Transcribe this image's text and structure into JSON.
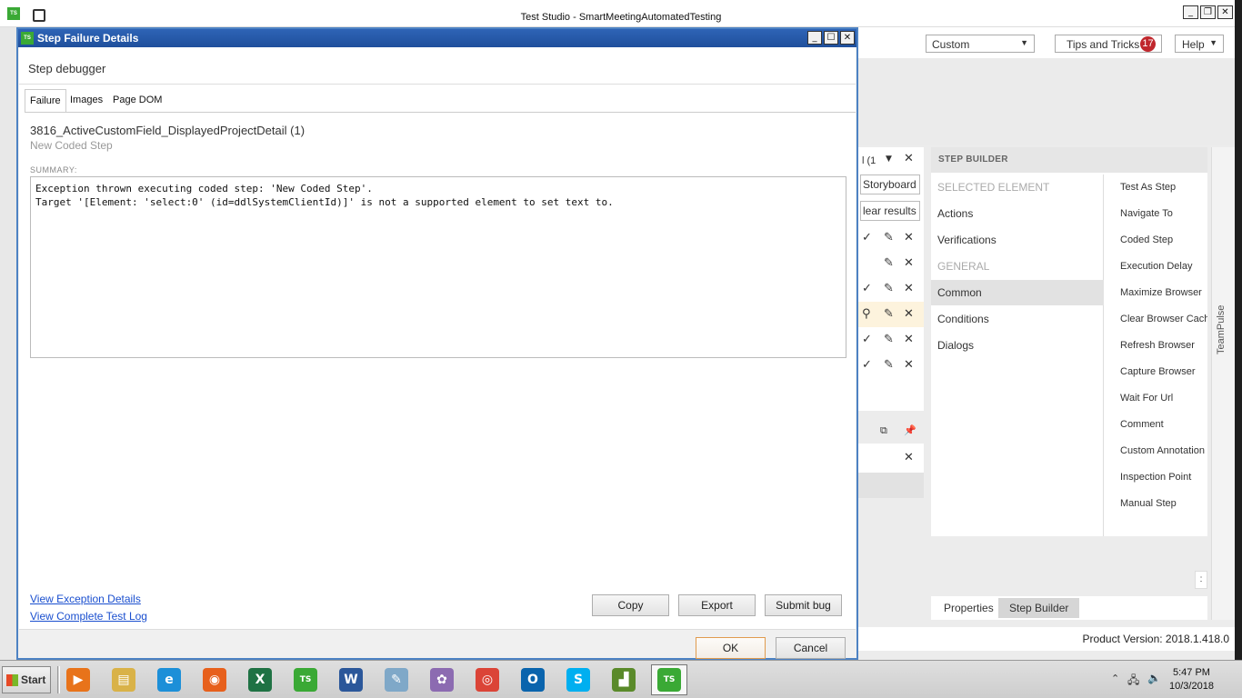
{
  "main_window": {
    "title": "Test Studio - SmartMeetingAutomatedTesting",
    "app_logo": "TS",
    "minimize": "_",
    "restore": "❐",
    "close": "✕"
  },
  "ribbon": {
    "view_select": "Custom",
    "tips_label": "Tips and Tricks",
    "tips_count": "17",
    "help_label": "Help"
  },
  "mid_panel": {
    "tab_fragment": "l (1",
    "storyboard": "Storyboard",
    "clear_results": "lear results"
  },
  "step_builder": {
    "header": "STEP BUILDER",
    "groups": [
      {
        "label": "SELECTED ELEMENT",
        "type": "group"
      },
      {
        "label": "Actions",
        "type": "item"
      },
      {
        "label": "Verifications",
        "type": "item"
      },
      {
        "label": "GENERAL",
        "type": "group"
      },
      {
        "label": "Common",
        "type": "active"
      },
      {
        "label": "Conditions",
        "type": "item"
      },
      {
        "label": "Dialogs",
        "type": "item"
      }
    ],
    "actions": [
      "Test As Step",
      "Navigate To",
      "Coded Step",
      "Execution Delay",
      "Maximize Browser",
      "Clear Browser Cach",
      "Refresh Browser",
      "Capture Browser",
      "Wait For Url",
      "Comment",
      "Custom Annotation",
      "Inspection Point",
      "Manual Step"
    ],
    "bottom_tabs": [
      "Properties",
      "Step Builder"
    ]
  },
  "teampulse_label": "TeamPulse",
  "status_bar": {
    "version": "Product Version: 2018.1.418.0"
  },
  "dialog": {
    "title": "Step Failure Details",
    "logo": "TS",
    "heading": "Step debugger",
    "tabs": [
      "Failure",
      "Images",
      "Page DOM"
    ],
    "test_name": "3816_ActiveCustomField_DisplayedProjectDetail (1)",
    "step_name": "New Coded Step",
    "summary_label": "SUMMARY:",
    "summary_lines": [
      "Exception thrown executing coded step: 'New Coded Step'.",
      "Target '[Element: 'select:0' (id=ddlSystemClientId)]' is not a supported element to set text to."
    ],
    "links": {
      "exception": "View Exception Details",
      "test_log": "View Complete Test Log"
    },
    "buttons": {
      "copy": "Copy",
      "export": "Export",
      "submit_bug": "Submit bug",
      "ok": "OK",
      "cancel": "Cancel"
    }
  },
  "taskbar": {
    "start": "Start",
    "apps": [
      {
        "name": "media-player",
        "glyph": "▶",
        "color": "#e8731a"
      },
      {
        "name": "file-explorer",
        "glyph": "▤",
        "color": "#d9b248"
      },
      {
        "name": "internet-explorer",
        "glyph": "e",
        "color": "#1c8fd8"
      },
      {
        "name": "firefox",
        "glyph": "◉",
        "color": "#e7601c"
      },
      {
        "name": "excel",
        "glyph": "X",
        "color": "#1f7244"
      },
      {
        "name": "test-studio",
        "glyph": "TS",
        "color": "#3aa935"
      },
      {
        "name": "word",
        "glyph": "W",
        "color": "#2b579a"
      },
      {
        "name": "notepad",
        "glyph": "✎",
        "color": "#7fa8c8"
      },
      {
        "name": "paint",
        "glyph": "✿",
        "color": "#8c6bb1"
      },
      {
        "name": "chrome",
        "glyph": "◎",
        "color": "#db4437"
      },
      {
        "name": "outlook",
        "glyph": "O",
        "color": "#0a64ad"
      },
      {
        "name": "skype",
        "glyph": "S",
        "color": "#00aff0"
      },
      {
        "name": "chart-app",
        "glyph": "▟",
        "color": "#5a8a2a"
      },
      {
        "name": "test-studio-active",
        "glyph": "TS",
        "color": "#3aa935"
      }
    ],
    "time": "5:47 PM",
    "date": "10/3/2018",
    "tray_up": "⌃",
    "network": "🖧",
    "volume": "🔈"
  }
}
